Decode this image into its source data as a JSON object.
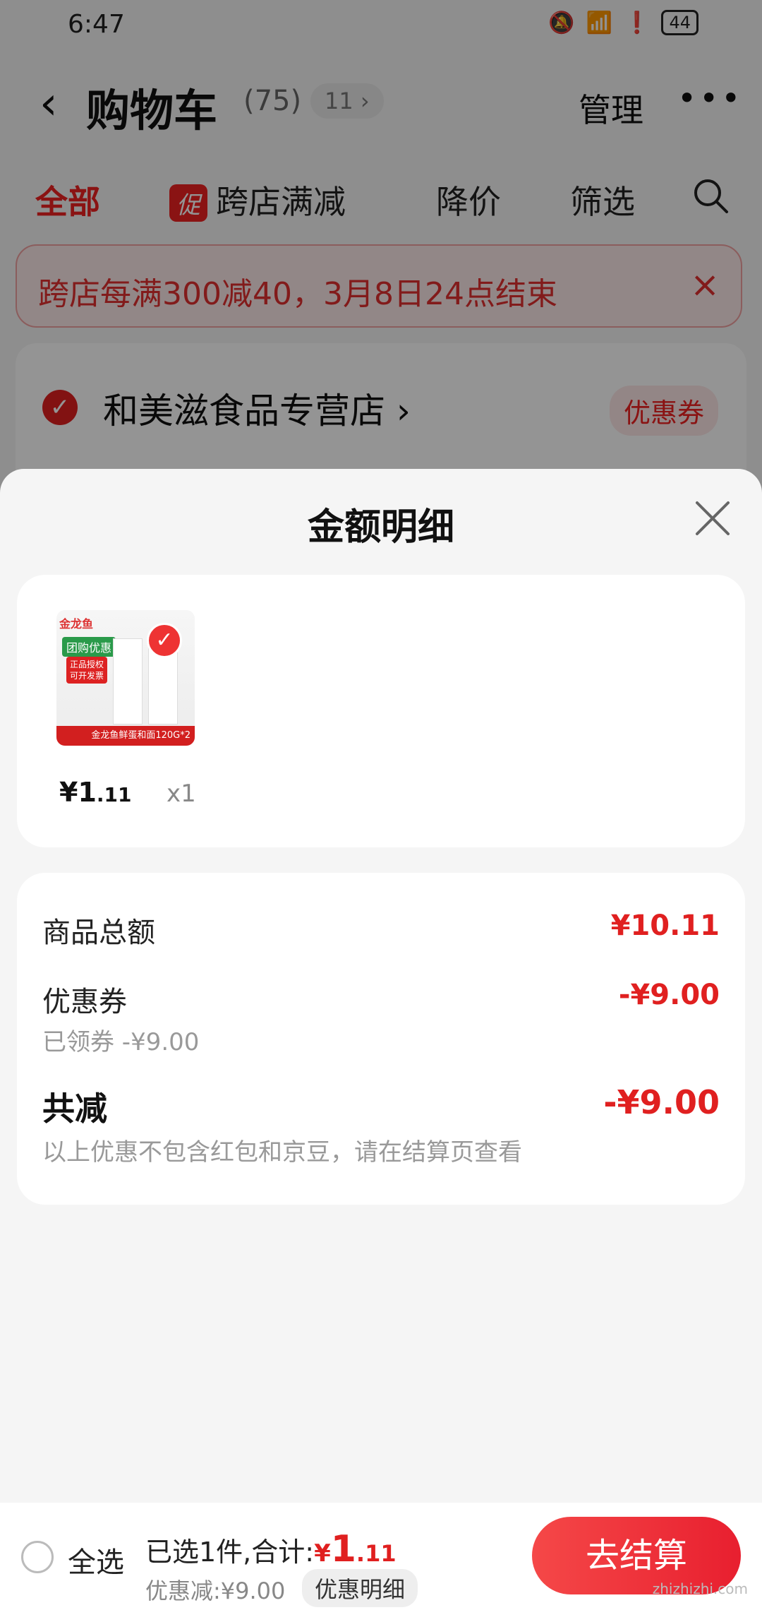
{
  "status_bar": {
    "time": "6:47",
    "battery": "44"
  },
  "header": {
    "title": "购物车",
    "count": "(75)",
    "pill": "11 ›",
    "manage": "管理",
    "more": "•••"
  },
  "tabs": {
    "all": "全部",
    "promo_tag": "促",
    "cross_store": "跨店满减",
    "price_drop": "降价",
    "filter": "筛选"
  },
  "banner": {
    "text": "跨店每满300减40，3月8日24点结束",
    "close": "×"
  },
  "shop": {
    "name": "和美滋食品专营店 ›",
    "coupon": "优惠券"
  },
  "sheet": {
    "title": "金额明细",
    "item": {
      "thumb_brand": "金龙鱼",
      "thumb_badge": "团购优惠",
      "thumb_auth_1": "正品授权",
      "thumb_auth_2": "可开发票",
      "thumb_caption": "金龙鱼鲜蛋和面120G*2",
      "price_int": "¥1",
      "price_dec": ".11",
      "qty": "x1"
    },
    "details": {
      "goods_total_label": "商品总额",
      "goods_total_value": "¥10.11",
      "coupon_label": "优惠券",
      "coupon_value": "-¥9.00",
      "coupon_sub": "已领券 -¥9.00",
      "total_discount_label": "共减",
      "total_discount_value": "-¥9.00",
      "note": "以上优惠不包含红包和京豆，请在结算页查看"
    }
  },
  "bottom_bar": {
    "select_all": "全选",
    "summary_prefix": "已选1件,合计:",
    "price_yen": "¥",
    "price_int": "1",
    "price_dec": ".11",
    "discount_text": "优惠减:¥9.00",
    "discount_detail": "优惠明细",
    "checkout": "去结算"
  },
  "watermark": "zhizhizhi.com",
  "colors": {
    "accent": "#e02020",
    "sheet_bg": "#f5f5f5"
  }
}
